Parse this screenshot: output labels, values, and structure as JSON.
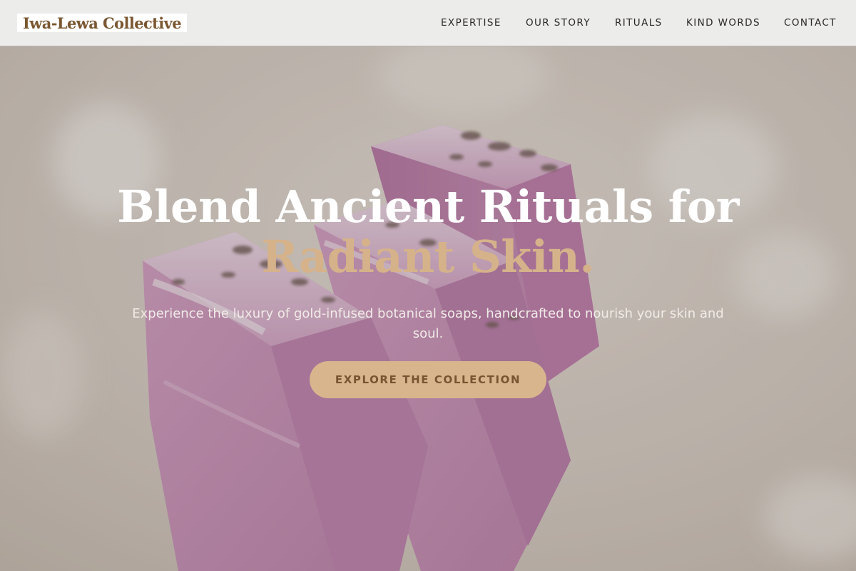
{
  "brand": {
    "name": "Iwa-Lewa Collective"
  },
  "nav": {
    "items": [
      "EXPERTISE",
      "OUR STORY",
      "RITUALS",
      "KIND WORDS",
      "CONTACT"
    ]
  },
  "hero": {
    "headline_line1": "Blend Ancient Rituals for",
    "headline_accent": "Radiant Skin.",
    "subtitle": "Experience the luxury of gold-infused botanical soaps, handcrafted to nourish your skin and soul.",
    "cta_label": "EXPLORE THE COLLECTION"
  },
  "colors": {
    "header_bg": "#ececeb",
    "brand_text": "#7a5731",
    "accent_gold": "#d6b28a",
    "cta_bg": "#d8b58c",
    "cta_text": "#7a5432",
    "soap_pink": "#c98fb7"
  }
}
